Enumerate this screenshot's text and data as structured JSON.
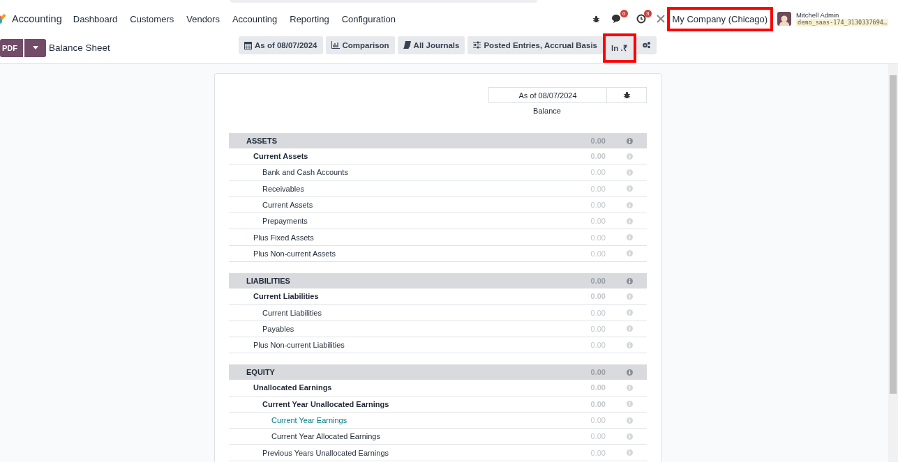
{
  "app": {
    "name": "Accounting"
  },
  "menu": [
    "Dashboard",
    "Customers",
    "Vendors",
    "Accounting",
    "Reporting",
    "Configuration"
  ],
  "systray": {
    "messages_count": "0",
    "activities_count": "3",
    "company": "My Company (Chicago)",
    "company_highlighted": true,
    "user": "Mitchell Admin",
    "database": "demo_saas-174_3130337694…"
  },
  "control_bar": {
    "print_button": "PDF",
    "title": "Balance Sheet",
    "filters": [
      {
        "label": "As of 08/07/2024",
        "kind": "calendar",
        "highlighted": false
      },
      {
        "label": "Comparison",
        "kind": "chart",
        "highlighted": false
      },
      {
        "label": "All Journals",
        "kind": "book",
        "highlighted": false
      },
      {
        "label": "Posted Entries, Accrual Basis",
        "kind": "sliders",
        "highlighted": false
      },
      {
        "label": "In .₹",
        "kind": "plain",
        "highlighted": true
      },
      {
        "kind": "settings",
        "highlighted": false
      }
    ]
  },
  "report": {
    "column_header": "As of 08/07/2024",
    "column_label": "Balance",
    "sections": [
      {
        "name": "ASSETS",
        "value": "0.00",
        "kind": "section",
        "children": [
          {
            "name": "Current Assets",
            "value": "0.00",
            "kind": "group",
            "children": [
              {
                "name": "Bank and Cash Accounts",
                "value": "0.00",
                "kind": "line"
              },
              {
                "name": "Receivables",
                "value": "0.00",
                "kind": "line"
              },
              {
                "name": "Current Assets",
                "value": "0.00",
                "kind": "line"
              },
              {
                "name": "Prepayments",
                "value": "0.00",
                "kind": "line"
              }
            ]
          },
          {
            "name": "Plus Fixed Assets",
            "value": "0.00",
            "kind": "line"
          },
          {
            "name": "Plus Non-current Assets",
            "value": "0.00",
            "kind": "line"
          }
        ]
      },
      {
        "name": "LIABILITIES",
        "value": "0.00",
        "kind": "section",
        "children": [
          {
            "name": "Current Liabilities",
            "value": "0.00",
            "kind": "group",
            "children": [
              {
                "name": "Current Liabilities",
                "value": "0.00",
                "kind": "line"
              },
              {
                "name": "Payables",
                "value": "0.00",
                "kind": "line"
              }
            ]
          },
          {
            "name": "Plus Non-current Liabilities",
            "value": "0.00",
            "kind": "line"
          }
        ]
      },
      {
        "name": "EQUITY",
        "value": "0.00",
        "kind": "section",
        "children": [
          {
            "name": "Unallocated Earnings",
            "value": "0.00",
            "kind": "group",
            "children": [
              {
                "name": "Current Year Unallocated Earnings",
                "value": "0.00",
                "kind": "group",
                "children": [
                  {
                    "name": "Current Year Earnings",
                    "value": "0.00",
                    "kind": "link"
                  },
                  {
                    "name": "Current Year Allocated Earnings",
                    "value": "0.00",
                    "kind": "line"
                  }
                ]
              },
              {
                "name": "Previous Years Unallocated Earnings",
                "value": "0.00",
                "kind": "line"
              }
            ]
          }
        ]
      }
    ]
  }
}
